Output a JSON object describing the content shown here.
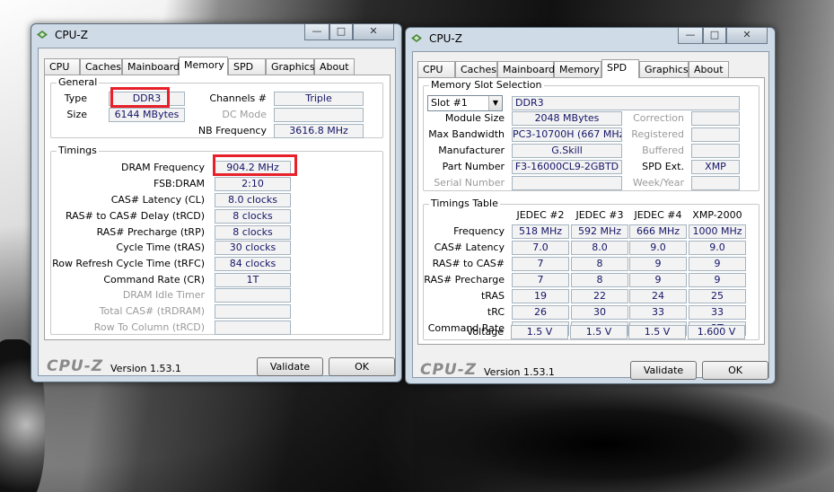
{
  "left_window": {
    "title": "CPU-Z",
    "controls": {
      "minimize": "—",
      "maximize": "□",
      "close": "✕"
    },
    "tabs": [
      "CPU",
      "Caches",
      "Mainboard",
      "Memory",
      "SPD",
      "Graphics",
      "About"
    ],
    "active_tab": "Memory",
    "general": {
      "label": "General",
      "type_label": "Type",
      "type_value": "DDR3",
      "size_label": "Size",
      "size_value": "6144 MBytes",
      "channels_label": "Channels #",
      "channels_value": "Triple",
      "dcmode_label": "DC Mode",
      "dcmode_value": "",
      "nbfreq_label": "NB Frequency",
      "nbfreq_value": "3616.8 MHz"
    },
    "timings": {
      "label": "Timings",
      "rows": [
        {
          "label": "DRAM Frequency",
          "value": "904.2 MHz",
          "disabled": false
        },
        {
          "label": "FSB:DRAM",
          "value": "2:10",
          "disabled": false
        },
        {
          "label": "CAS# Latency (CL)",
          "value": "8.0 clocks",
          "disabled": false
        },
        {
          "label": "RAS# to CAS# Delay (tRCD)",
          "value": "8 clocks",
          "disabled": false
        },
        {
          "label": "RAS# Precharge (tRP)",
          "value": "8 clocks",
          "disabled": false
        },
        {
          "label": "Cycle Time (tRAS)",
          "value": "30 clocks",
          "disabled": false
        },
        {
          "label": "Row Refresh Cycle Time (tRFC)",
          "value": "84 clocks",
          "disabled": false
        },
        {
          "label": "Command Rate (CR)",
          "value": "1T",
          "disabled": false
        },
        {
          "label": "DRAM Idle Timer",
          "value": "",
          "disabled": true
        },
        {
          "label": "Total CAS# (tRDRAM)",
          "value": "",
          "disabled": true
        },
        {
          "label": "Row To Column (tRCD)",
          "value": "",
          "disabled": true
        }
      ]
    },
    "footer": {
      "logo": "CPU-Z",
      "version": "Version 1.53.1",
      "validate": "Validate",
      "ok": "OK"
    }
  },
  "right_window": {
    "title": "CPU-Z",
    "controls": {
      "minimize": "—",
      "maximize": "□",
      "close": "✕"
    },
    "tabs": [
      "CPU",
      "Caches",
      "Mainboard",
      "Memory",
      "SPD",
      "Graphics",
      "About"
    ],
    "active_tab": "SPD",
    "slot_group": {
      "label": "Memory Slot Selection",
      "slot_selected": "Slot #1",
      "slot_type": "DDR3",
      "module_size_label": "Module Size",
      "module_size_value": "2048 MBytes",
      "max_bw_label": "Max Bandwidth",
      "max_bw_value": "PC3-10700H (667 MHz)",
      "manufacturer_label": "Manufacturer",
      "manufacturer_value": "G.Skill",
      "part_label": "Part Number",
      "part_value": "F3-16000CL9-2GBTD",
      "serial_label": "Serial Number",
      "serial_value": "",
      "correction_label": "Correction",
      "correction_value": "",
      "registered_label": "Registered",
      "registered_value": "",
      "buffered_label": "Buffered",
      "buffered_value": "",
      "spdext_label": "SPD Ext.",
      "spdext_value": "XMP",
      "weekyear_label": "Week/Year",
      "weekyear_value": ""
    },
    "timings_table": {
      "label": "Timings Table",
      "columns": [
        "JEDEC #2",
        "JEDEC #3",
        "JEDEC #4",
        "XMP-2000"
      ],
      "rows": [
        {
          "label": "Frequency",
          "values": [
            "518 MHz",
            "592 MHz",
            "666 MHz",
            "1000 MHz"
          ]
        },
        {
          "label": "CAS# Latency",
          "values": [
            "7.0",
            "8.0",
            "9.0",
            "9.0"
          ]
        },
        {
          "label": "RAS# to CAS#",
          "values": [
            "7",
            "8",
            "9",
            "9"
          ]
        },
        {
          "label": "RAS# Precharge",
          "values": [
            "7",
            "8",
            "9",
            "9"
          ]
        },
        {
          "label": "tRAS",
          "values": [
            "19",
            "22",
            "24",
            "25"
          ]
        },
        {
          "label": "tRC",
          "values": [
            "26",
            "30",
            "33",
            "33"
          ]
        },
        {
          "label": "Command Rate",
          "values": [
            "",
            "",
            "",
            "2T"
          ]
        },
        {
          "label": "Voltage",
          "values": [
            "1.5 V",
            "1.5 V",
            "1.5 V",
            "1.600 V"
          ]
        }
      ]
    },
    "footer": {
      "logo": "CPU-Z",
      "version": "Version 1.53.1",
      "validate": "Validate",
      "ok": "OK"
    }
  },
  "colors": {
    "value_text": "#141468",
    "highlight": "#e8202a",
    "window_frame": "#cfdbe7"
  }
}
